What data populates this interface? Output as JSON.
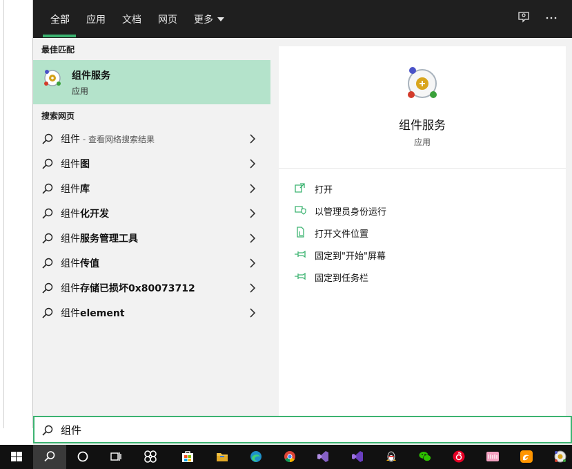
{
  "tabs": [
    {
      "label": "全部",
      "active": true
    },
    {
      "label": "应用"
    },
    {
      "label": "文档"
    },
    {
      "label": "网页"
    },
    {
      "label": "更多"
    }
  ],
  "topbar_icons": [
    "feedback-icon",
    "more-options-icon"
  ],
  "best_match": {
    "section_title": "最佳匹配",
    "name": "组件服务",
    "type": "应用"
  },
  "web": {
    "section_title": "搜索网页",
    "items": [
      {
        "prefix": "组件",
        "bold": "",
        "hint": " - 查看网络搜索结果"
      },
      {
        "prefix": "组件",
        "bold": "图",
        "hint": ""
      },
      {
        "prefix": "组件",
        "bold": "库",
        "hint": ""
      },
      {
        "prefix": "组件",
        "bold": "化开发",
        "hint": ""
      },
      {
        "prefix": "组件",
        "bold": "服务管理工具",
        "hint": ""
      },
      {
        "prefix": "组件",
        "bold": "传值",
        "hint": ""
      },
      {
        "prefix": "组件",
        "bold": "存储已损坏0x80073712",
        "hint": ""
      },
      {
        "prefix": "组件",
        "bold": "element",
        "hint": ""
      }
    ]
  },
  "detail": {
    "name": "组件服务",
    "type": "应用",
    "actions": [
      {
        "label": "打开",
        "icon": "open-icon"
      },
      {
        "label": "以管理员身份运行",
        "icon": "admin-shield-icon"
      },
      {
        "label": "打开文件位置",
        "icon": "file-location-icon"
      },
      {
        "label": "固定到\"开始\"屏幕",
        "icon": "pin-icon"
      },
      {
        "label": "固定到任务栏",
        "icon": "pin-icon"
      }
    ]
  },
  "search": {
    "value": "组件"
  },
  "taskbar": {
    "items": [
      "windows-start-icon",
      "search-icon",
      "cortana-icon",
      "task-view-icon",
      "app-pinwheel-icon",
      "microsoft-store-icon",
      "file-explorer-icon",
      "edge-icon",
      "chrome-icon",
      "visual-studio-icon",
      "visual-studio-2-icon",
      "qq-icon",
      "wechat-icon",
      "netease-music-icon",
      "bilibili-icon",
      "uc-browser-icon",
      "component-services-icon"
    ]
  },
  "colors": {
    "accent": "#3cb371",
    "selected_bg": "#b4e3cb",
    "topbar_bg": "#1f1f1f",
    "taskbar_bg": "#111111"
  }
}
